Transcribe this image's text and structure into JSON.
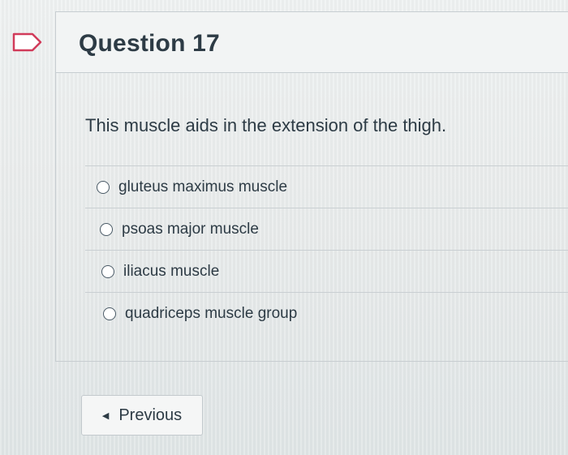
{
  "question": {
    "title": "Question 17",
    "text": "This muscle aids in the extension of the thigh.",
    "answers": [
      {
        "label": "gluteus maximus muscle"
      },
      {
        "label": "psoas major muscle"
      },
      {
        "label": "iliacus muscle"
      },
      {
        "label": "quadriceps muscle group"
      }
    ]
  },
  "navigation": {
    "previous_label": "Previous",
    "previous_icon": "triangle-left-icon"
  },
  "icons": {
    "flag": "bookmark-flag-icon"
  },
  "colors": {
    "flag_stroke": "#d13b5a",
    "text": "#2d3b45",
    "border": "#c7cdd1"
  }
}
